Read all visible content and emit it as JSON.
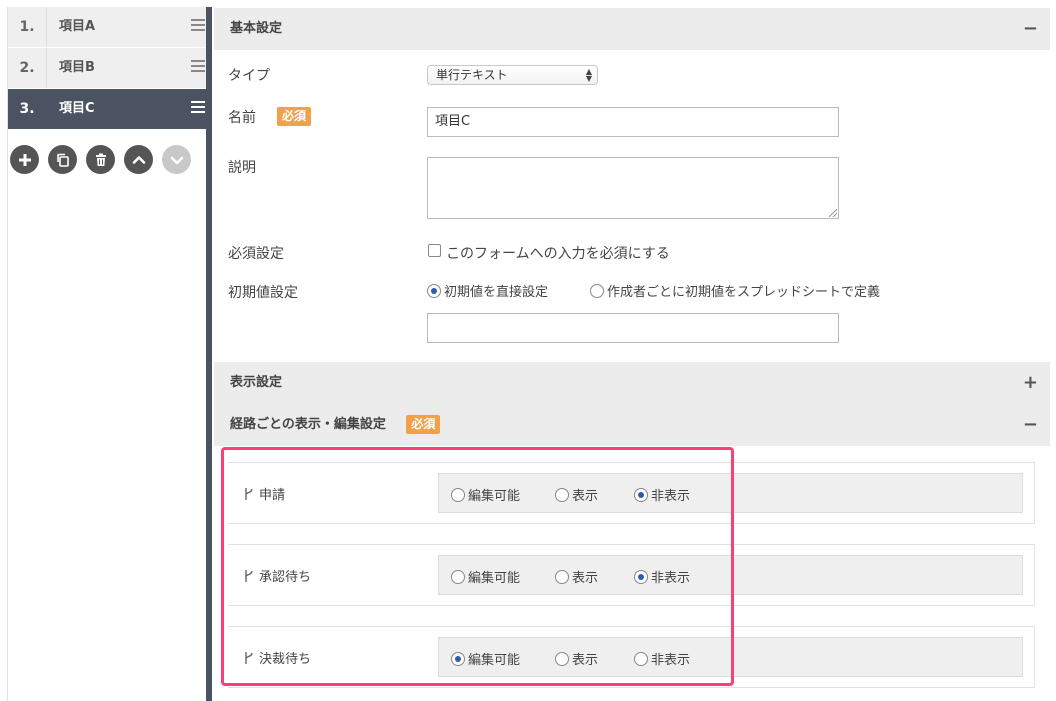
{
  "items": [
    {
      "num": "1.",
      "label": "項目A"
    },
    {
      "num": "2.",
      "label": "項目B"
    },
    {
      "num": "3.",
      "label": "項目C"
    }
  ],
  "tool_icons": [
    "add-icon",
    "copy-icon",
    "delete-icon",
    "move-up-icon",
    "move-down-icon"
  ],
  "basic": {
    "title": "基本設定",
    "toggle": "−",
    "type_label": "タイプ",
    "type_value": "単行テキスト",
    "name_label": "名前",
    "required_badge": "必須",
    "name_value": "項目C",
    "desc_label": "説明",
    "required_label": "必須設定",
    "required_check": "このフォームへの入力を必須にする",
    "initial_label": "初期値設定",
    "initial_opt1": "初期値を直接設定",
    "initial_opt2": "作成者ごとに初期値をスプレッドシートで定義"
  },
  "display": {
    "title": "表示設定",
    "toggle": "+"
  },
  "route": {
    "title": "経路ごとの表示・編集設定",
    "badge": "必須",
    "toggle": "−",
    "opt_edit": "編集可能",
    "opt_show": "表示",
    "opt_hide": "非表示",
    "rows": [
      {
        "name": "申請",
        "selected": "非表示"
      },
      {
        "name": "承認待ち",
        "selected": "非表示"
      },
      {
        "name": "決裁待ち",
        "selected": "編集可能"
      }
    ]
  },
  "colors": {
    "accent": "#4b5262",
    "badge": "#f0a24a",
    "highlight": "#ff3d77",
    "radio": "#2a5dab"
  }
}
